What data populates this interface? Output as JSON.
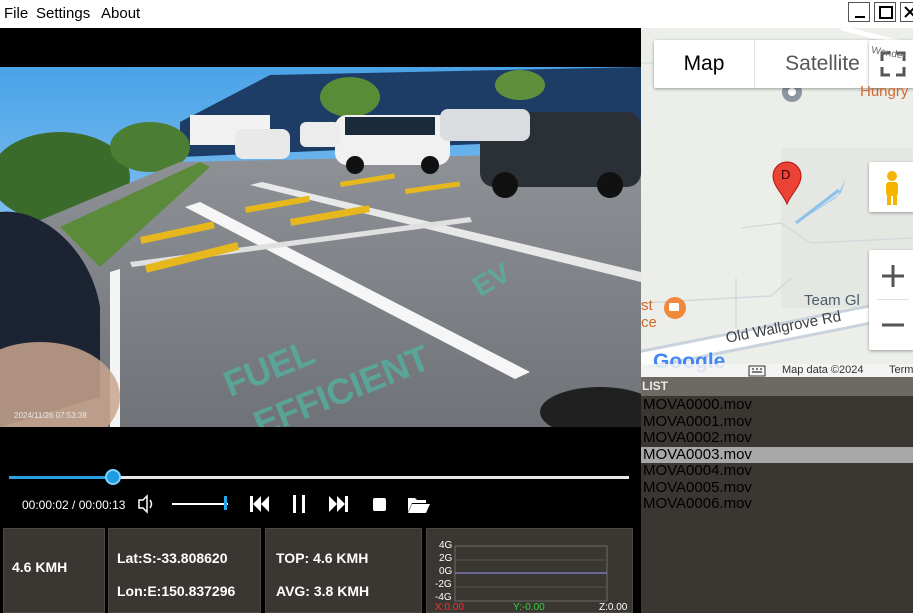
{
  "menu": {
    "items": [
      "File",
      "Settings",
      "About"
    ]
  },
  "video": {
    "timestamp": "2024/11/26  07:53:38"
  },
  "playback": {
    "time_label": "00:00:02 / 00:00:13",
    "progress": 0.168,
    "volume": 0.92
  },
  "info": {
    "speed": "4.6 KMH",
    "lat": "Lat:S:-33.808620",
    "lon": "Lon:E:150.837296",
    "top": "TOP: 4.6 KMH",
    "avg": "AVG: 3.8 KMH"
  },
  "gsensor": {
    "ticks": [
      "4G",
      "2G",
      "0G",
      "-2G",
      "-4G"
    ],
    "x_label": "X:0.00",
    "y_label": "Y:-0.00",
    "z_label": "Z:0.00",
    "colors": {
      "x": "#ff3030",
      "y": "#3ccf3c",
      "z": "#ffffff"
    }
  },
  "map": {
    "tabs": [
      "Map",
      "Satellite"
    ],
    "labels": {
      "top_right": "Hungry",
      "top_road": "Wonder",
      "team": "Team Gl",
      "road": "Old Wallgrove Rd",
      "left_a": "st",
      "left_b": "ce",
      "marker": "D"
    },
    "footer": {
      "map_data": "Map data ©2024",
      "terms": "Term"
    },
    "google_logo": "Google"
  },
  "list": {
    "header": "LIST",
    "files": [
      "MOVA0000.mov",
      "MOVA0001.mov",
      "MOVA0002.mov",
      "MOVA0003.mov",
      "MOVA0004.mov",
      "MOVA0005.mov",
      "MOVA0006.mov"
    ],
    "selected_index": 3
  }
}
